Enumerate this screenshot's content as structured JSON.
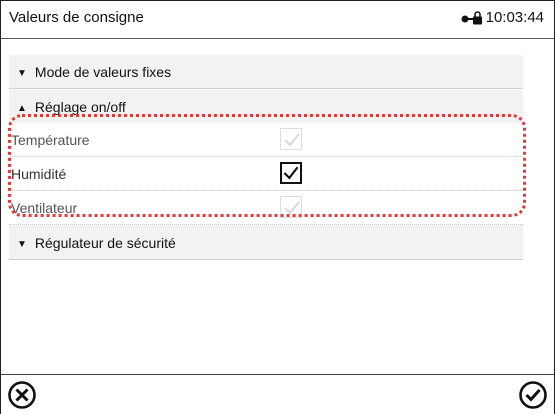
{
  "header": {
    "title": "Valeurs de consigne",
    "time": "10:03:44",
    "lock_icon": "lock-icon"
  },
  "sections": {
    "fixed_mode": {
      "label": "Mode de valeurs fixes",
      "state": "collapsed",
      "icon": "triangle-down-icon"
    },
    "onoff": {
      "label": "Réglage on/off",
      "state": "expanded",
      "icon": "triangle-up-icon"
    },
    "safety": {
      "label": "Régulateur de sécurité",
      "state": "collapsed",
      "icon": "triangle-down-icon"
    }
  },
  "onoff_items": [
    {
      "label": "Température",
      "checked": true,
      "enabled": false
    },
    {
      "label": "Humidité",
      "checked": true,
      "enabled": true
    },
    {
      "label": "Ventilateur",
      "checked": true,
      "enabled": false
    }
  ],
  "footer": {
    "cancel_icon": "cancel-circle-icon",
    "confirm_icon": "confirm-check-circle-icon"
  },
  "colors": {
    "highlight": "#e23a3a",
    "section_bg": "#f2f2f2"
  }
}
